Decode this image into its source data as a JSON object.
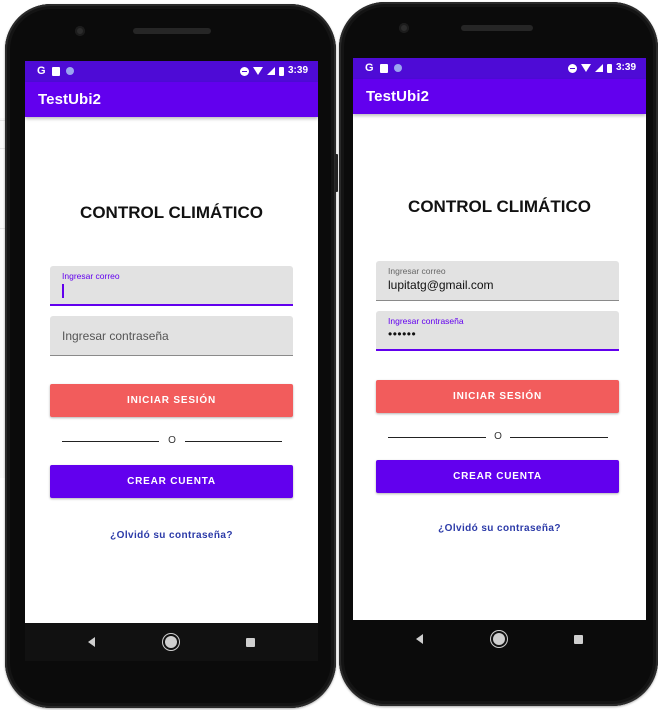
{
  "colors": {
    "status_bar": "#4e0bd6",
    "app_bar": "#6200ee",
    "login_button": "#f25c5c",
    "create_button": "#6200ee",
    "link": "#2b3aa8"
  },
  "status_bar": {
    "time": "3:39",
    "left_icons": [
      "google-g-icon",
      "sd-card-icon",
      "circle-notification-icon"
    ],
    "right_icons": [
      "do-not-disturb-icon",
      "wifi-icon",
      "cell-signal-icon",
      "battery-icon"
    ]
  },
  "phones": [
    {
      "app_title": "TestUbi2",
      "heading": "CONTROL CLIMÁTICO",
      "email_field": {
        "label": "Ingresar correo",
        "value": "",
        "focused": true
      },
      "password_field": {
        "placeholder": "Ingresar contraseña",
        "value": "",
        "focused": false
      },
      "login_button": "INICIAR SESIÓN",
      "divider_text": "O",
      "create_button": "CREAR CUENTA",
      "forgot_link": "¿Olvidó su contraseña?"
    },
    {
      "app_title": "TestUbi2",
      "heading": "CONTROL CLIMÁTICO",
      "email_field": {
        "label": "Ingresar correo",
        "value": "lupitatg@gmail.com",
        "focused": false
      },
      "password_field": {
        "label": "Ingresar contraseña",
        "value": "••••••",
        "focused": true
      },
      "login_button": "INICIAR SESIÓN",
      "divider_text": "O",
      "create_button": "CREAR CUENTA",
      "forgot_link": "¿Olvidó su contraseña?"
    }
  ],
  "nav_bar": {
    "icons": [
      "back-icon",
      "home-icon",
      "recent-apps-icon"
    ]
  }
}
